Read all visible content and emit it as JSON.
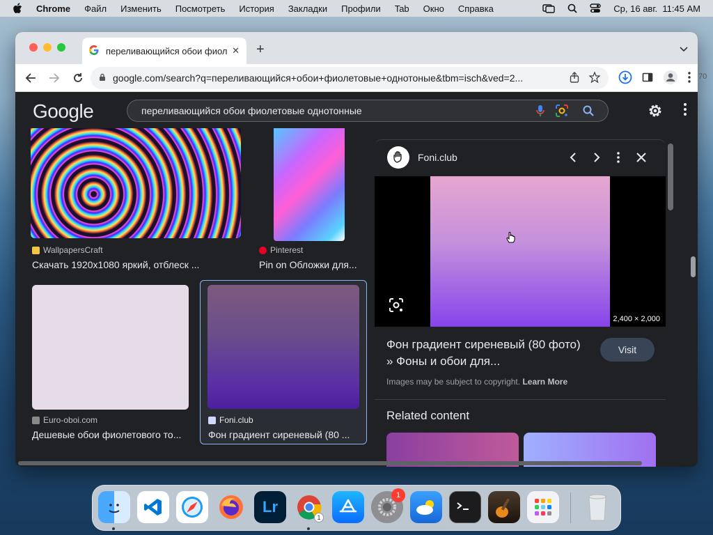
{
  "menubar": {
    "app": "Chrome",
    "items": [
      "Файл",
      "Изменить",
      "Посмотреть",
      "История",
      "Закладки",
      "Профили",
      "Tab",
      "Окно",
      "Справка"
    ],
    "datetime": "Ср, 16 авг.  11:45 AM"
  },
  "browser": {
    "tab_title": "переливающийся обои фиолетовые однотонные",
    "url": "google.com/search?q=переливающийся+обои+фиолетовые+однотоные&tbm=isch&ved=2...",
    "side_text": "70"
  },
  "google": {
    "logo": "Google",
    "query": "переливающийся обои фиолетовые однотонные"
  },
  "results": [
    {
      "source": "WallpapersCraft",
      "caption": "Скачать 1920x1080 яркий, отблеск ...",
      "fav_color": "#f4c542"
    },
    {
      "source": "Pinterest",
      "caption": "Pin on Обложки для...",
      "fav_color": "#e60023"
    },
    {
      "source": "Euro-oboi.com",
      "caption": "Дешевые обои фиолетового то...",
      "fav_color": "#888888"
    },
    {
      "source": "Foni.club",
      "caption": "Фон градиент сиреневый (80 ...",
      "fav_color": "#cfd8ff"
    }
  ],
  "preview": {
    "site": "Foni.club",
    "dimensions": "2,400 × 2,000",
    "title": "Фон градиент сиреневый (80 фото) » Фоны и обои для...",
    "visit": "Visit",
    "copyright": "Images may be subject to copyright.",
    "learn_more": "Learn More",
    "related": "Related content"
  },
  "dock": {
    "badge": "1",
    "chrome_badge": "1"
  },
  "colors": {
    "accent": "#8ab4f8",
    "dark_bg": "#202124"
  }
}
